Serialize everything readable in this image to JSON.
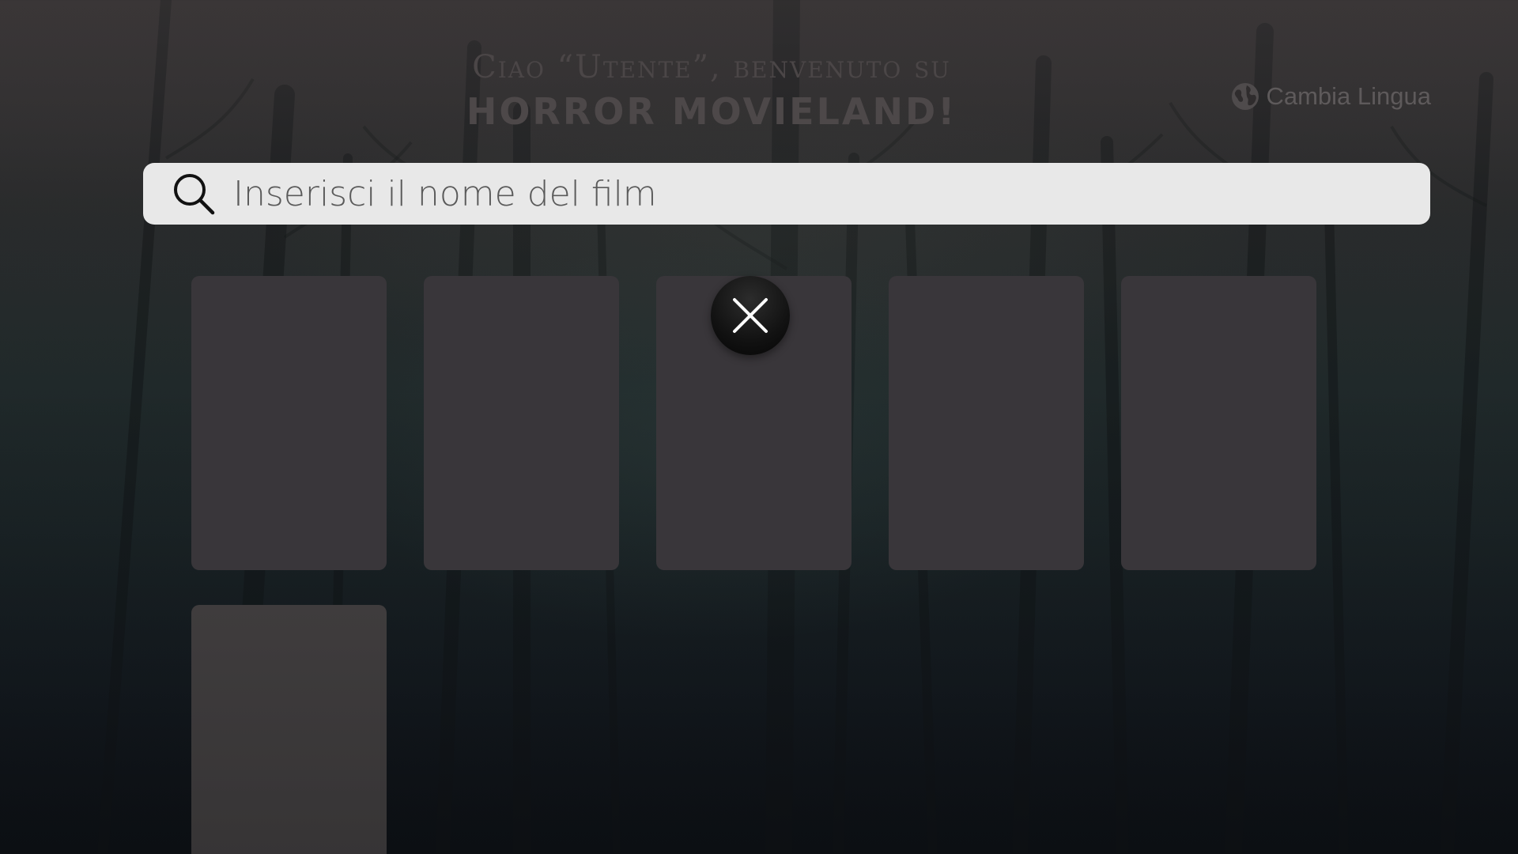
{
  "header": {
    "greeting": "Ciao “Utente”, benvenuto su",
    "brand": "HORROR MOVIELAND!",
    "language_button": {
      "label": "Cambia Lingua",
      "icon": "globe-icon"
    }
  },
  "search": {
    "placeholder": "Inserisci il nome del film",
    "value": "",
    "icon": "search-icon"
  },
  "movies": {
    "cards_count": 6
  },
  "close_button": {
    "icon": "close-icon"
  },
  "colors": {
    "search_background": "#e8e8e8",
    "card_background": "#39363a",
    "close_button": "#111111"
  }
}
